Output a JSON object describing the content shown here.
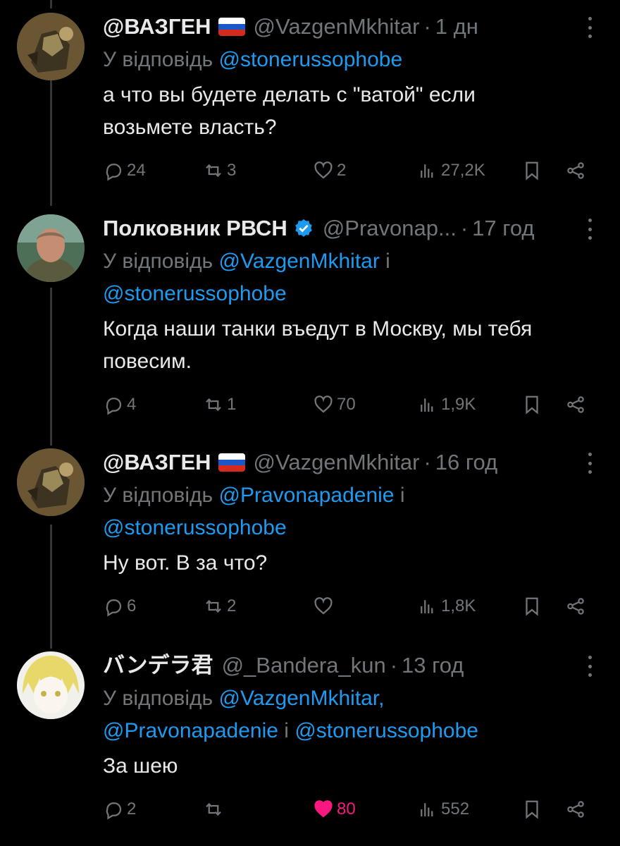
{
  "tweets": [
    {
      "name": "@ВАЗГЕН",
      "flag": "russia-flag",
      "handle": "@VazgenMkhitar",
      "time": "1 дн",
      "replying_prefix": "У відповідь ",
      "replying_mentions": [
        "@stonerussophobe"
      ],
      "text_lines": [
        "а что вы будете делать с \"ватой\" если",
        "возьмете власть?"
      ],
      "replies": "24",
      "retweets": "3",
      "likes": "2",
      "views": "27,2K",
      "liked": false
    },
    {
      "name": "Полковник РВСН",
      "verified": true,
      "handle": "@Pravonap...",
      "time": "17 год",
      "replying_prefix": "У відповідь ",
      "replying_mentions": [
        "@VazgenMkhitar",
        "@stonerussophobe"
      ],
      "replying_joiner": " і",
      "text_lines": [
        "Когда наши танки въедут в Москву, мы тебя",
        "повесим."
      ],
      "replies": "4",
      "retweets": "1",
      "likes": "70",
      "views": "1,9K",
      "liked": false
    },
    {
      "name": "@ВАЗГЕН",
      "flag": "russia-flag",
      "handle": "@VazgenMkhitar",
      "time": "16 год",
      "replying_prefix": "У відповідь ",
      "replying_mentions": [
        "@Pravonapadenie",
        "@stonerussophobe"
      ],
      "replying_joiner": " і",
      "text_lines": [
        "Ну вот. В за что?"
      ],
      "replies": "6",
      "retweets": "2",
      "likes": "",
      "views": "1,8K",
      "liked": false
    },
    {
      "name": "バンデラ君",
      "handle": "@_Bandera_kun",
      "time": "13 год",
      "replying_prefix": "У відповідь ",
      "replying_mentions": [
        "@VazgenMkhitar,",
        "@Pravonapadenie",
        "@stonerussophobe"
      ],
      "replying_joiner": " і ",
      "text_lines": [
        "За шею"
      ],
      "replies": "2",
      "retweets": "",
      "likes": "80",
      "views": "552",
      "liked": true
    }
  ],
  "colors": {
    "background": "#000000",
    "text": "#e7e9ea",
    "muted": "#71767b",
    "mention": "#1d9bf0",
    "like_active": "#f91880"
  },
  "icons": [
    "reply-icon",
    "retweet-icon",
    "like-icon",
    "views-icon",
    "bookmark-icon",
    "share-icon",
    "more-icon",
    "verified-icon"
  ]
}
